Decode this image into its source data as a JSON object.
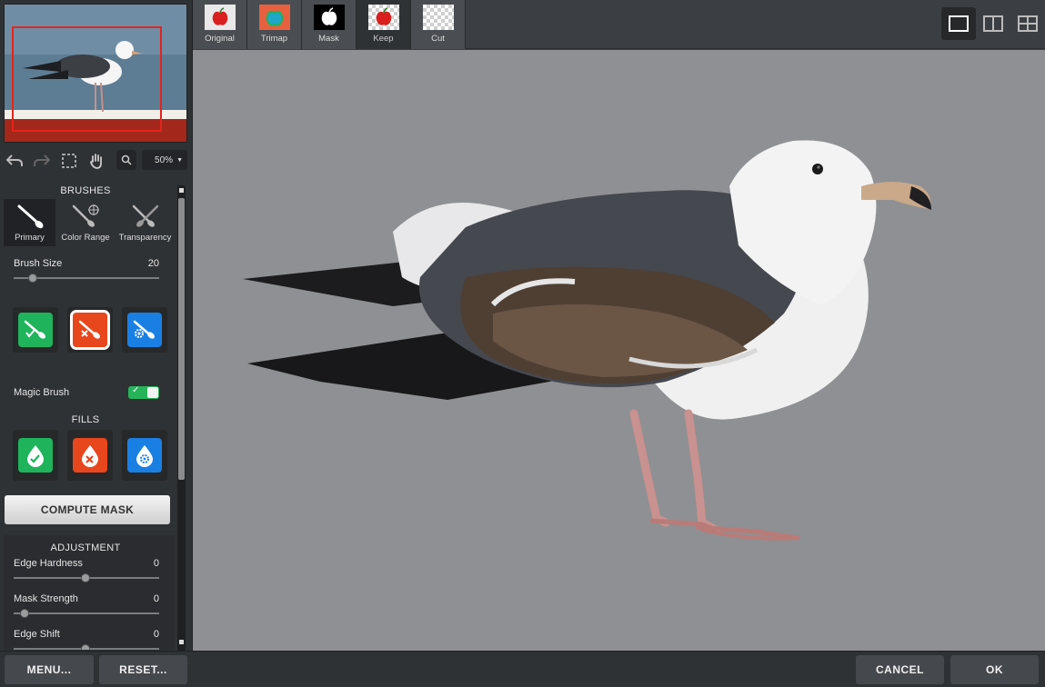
{
  "navigator": {
    "zoom": "50%"
  },
  "brushes": {
    "title": "BRUSHES",
    "tabs": [
      {
        "label": "Primary",
        "icon": "paint-brush-icon"
      },
      {
        "label": "Color Range",
        "icon": "color-range-brush-icon"
      },
      {
        "label": "Transparency",
        "icon": "transparency-brush-icon"
      }
    ],
    "brush_size_label": "Brush Size",
    "brush_size_value": "20",
    "magic_brush_label": "Magic Brush"
  },
  "fills": {
    "title": "FILLS"
  },
  "compute_mask_label": "COMPUTE MASK",
  "adjustment": {
    "title": "ADJUSTMENT",
    "sliders": [
      {
        "label": "Edge Hardness",
        "value": "0"
      },
      {
        "label": "Mask Strength",
        "value": "0"
      },
      {
        "label": "Edge Shift",
        "value": "0"
      }
    ]
  },
  "view_tabs": [
    {
      "label": "Original"
    },
    {
      "label": "Trimap"
    },
    {
      "label": "Mask"
    },
    {
      "label": "Keep"
    },
    {
      "label": "Cut"
    }
  ],
  "bottom": {
    "menu_label": "MENU...",
    "reset_label": "RESET...",
    "cancel_label": "CANCEL",
    "ok_label": "OK"
  },
  "colors": {
    "keep_green": "#1fb35c",
    "cut_red": "#e8461c",
    "auto_blue": "#1a7fe3",
    "canvas_gray": "#8f9093",
    "nav_rect": "#e3241d"
  }
}
